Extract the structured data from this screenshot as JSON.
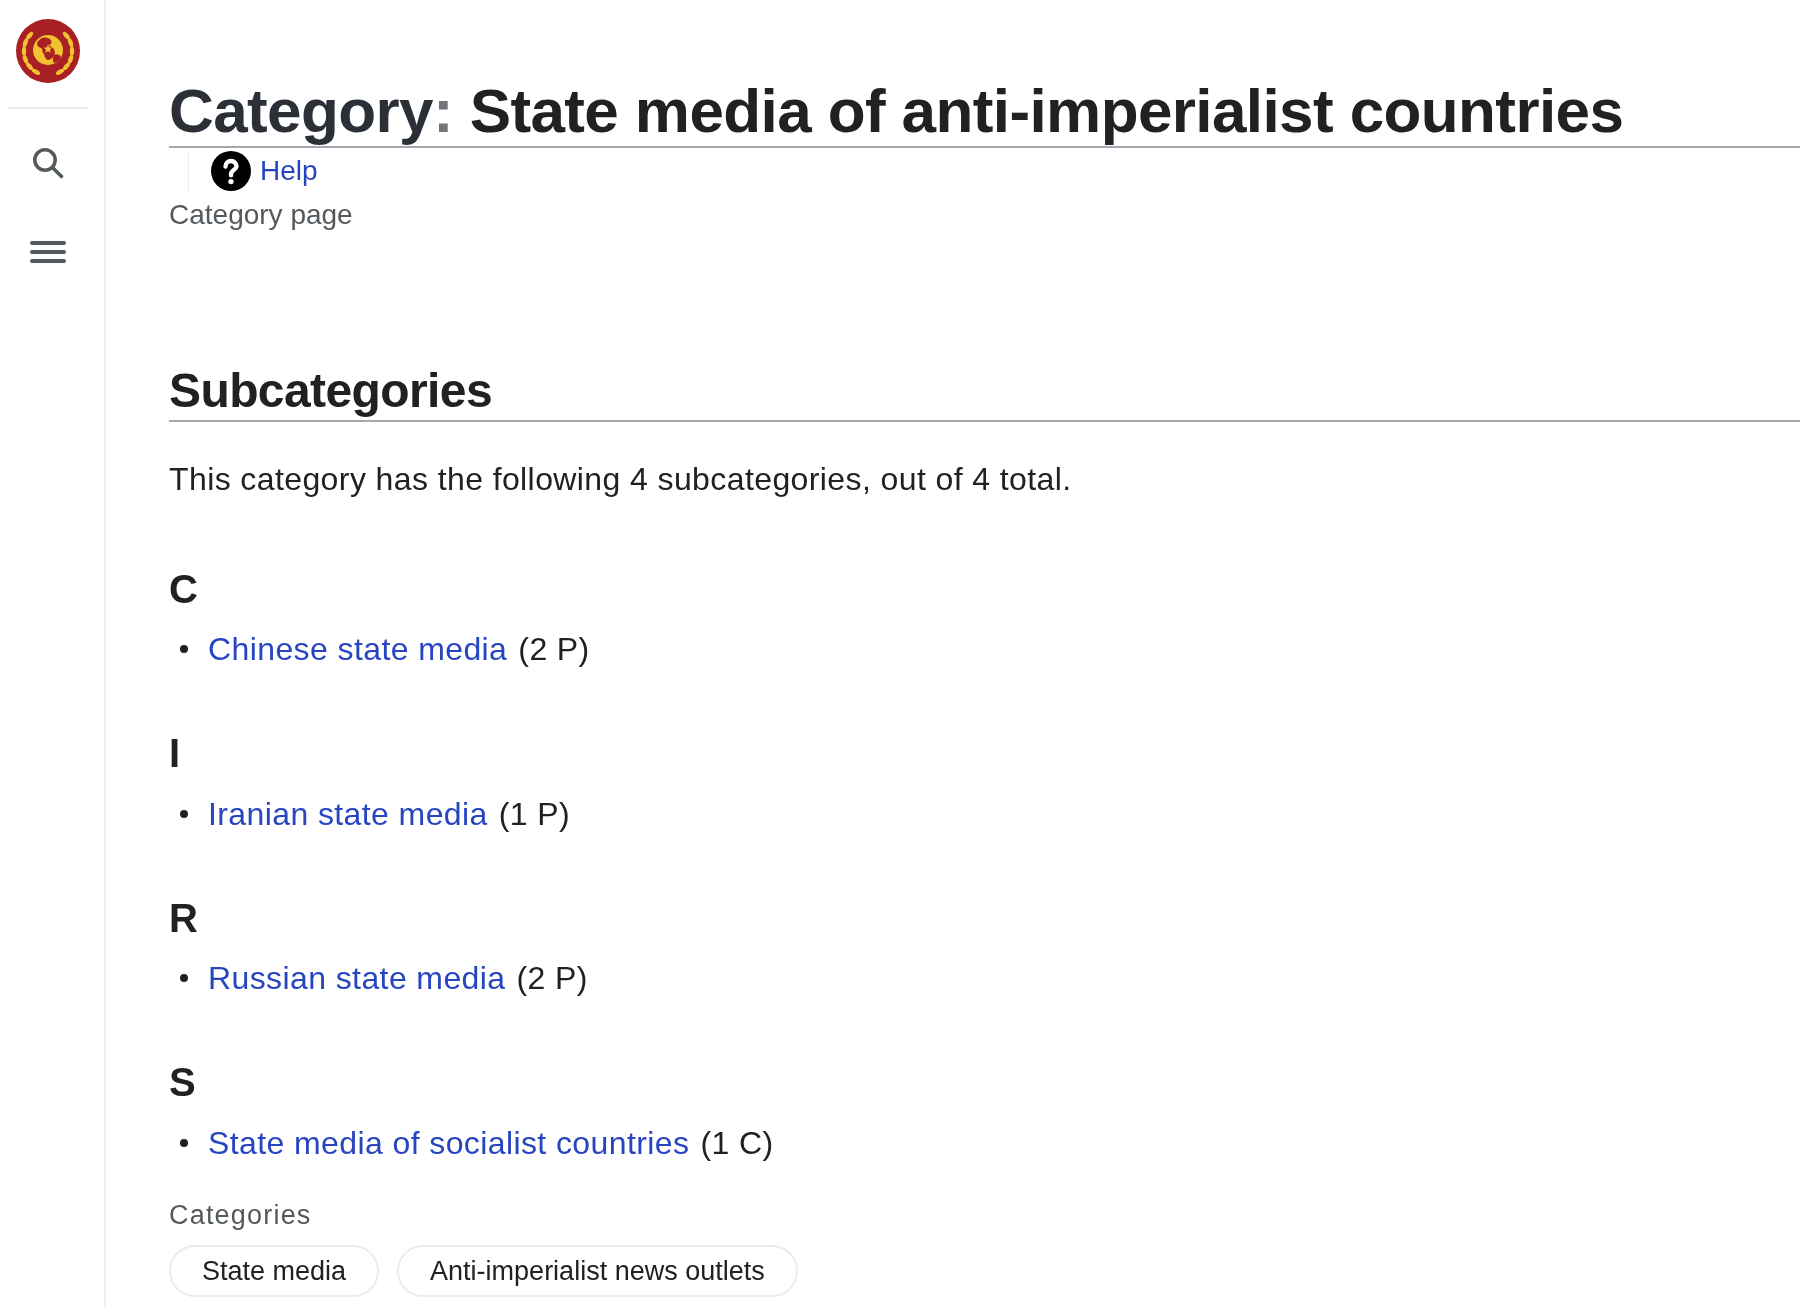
{
  "title": {
    "namespace": "Category",
    "separator": ":",
    "name": "State media of anti-imperialist countries"
  },
  "indicators": [
    {
      "label": "Help"
    }
  ],
  "subtitle": "Category page",
  "subcategories": {
    "heading": "Subcategories",
    "summary": "This category has the following 4 subcategories, out of 4 total.",
    "groups": [
      {
        "letter": "C",
        "items": [
          {
            "link": "Chinese state media",
            "count": "(2 P)"
          }
        ]
      },
      {
        "letter": "I",
        "items": [
          {
            "link": "Iranian state media",
            "count": "(1 P)"
          }
        ]
      },
      {
        "letter": "R",
        "items": [
          {
            "link": "Russian state media",
            "count": "(2 P)"
          }
        ]
      },
      {
        "letter": "S",
        "items": [
          {
            "link": "State media of socialist countries",
            "count": "(1 C)"
          }
        ]
      }
    ]
  },
  "categories": {
    "label": "Categories",
    "items": [
      "State media",
      "Anti-imperialist news outlets"
    ]
  }
}
